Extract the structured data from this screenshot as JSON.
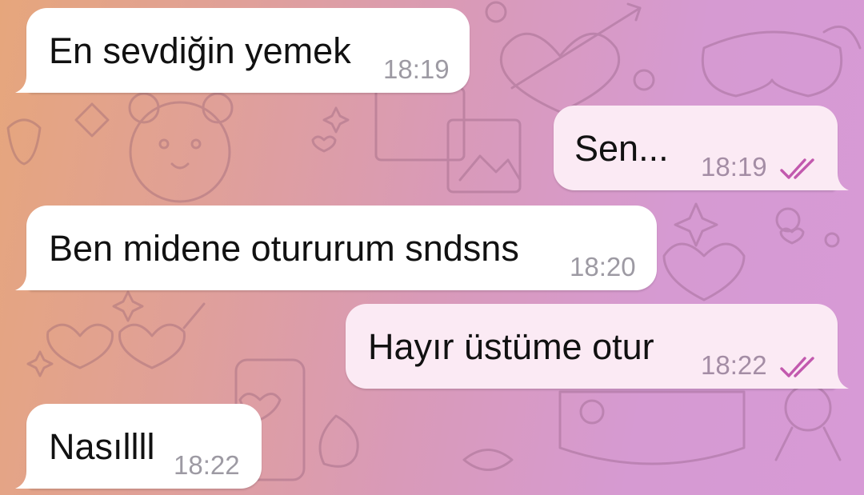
{
  "chat": {
    "messages": [
      {
        "direction": "incoming",
        "text": "En sevdiğin yemek",
        "time": "18:19"
      },
      {
        "direction": "outgoing",
        "text": "Sen...",
        "time": "18:19",
        "status": "read-double-check"
      },
      {
        "direction": "incoming",
        "text": "Ben midene otururum sndsns",
        "time": "18:20"
      },
      {
        "direction": "outgoing",
        "text": "Hayır üstüme otur",
        "time": "18:22",
        "status": "read-double-check"
      },
      {
        "direction": "incoming",
        "text": "Nasıllll",
        "time": "18:22"
      }
    ]
  },
  "colors": {
    "background_gradient": [
      "#e6a67c",
      "#d99ab8",
      "#d79ad6"
    ],
    "incoming_bubble": "#ffffff",
    "outgoing_bubble": "#fbeaf4",
    "read_check": "#c259ae",
    "timestamp": "#9d9aa3"
  },
  "icons": {
    "read_status": "double-check-icon",
    "wallpaper": "doodle-pattern"
  }
}
